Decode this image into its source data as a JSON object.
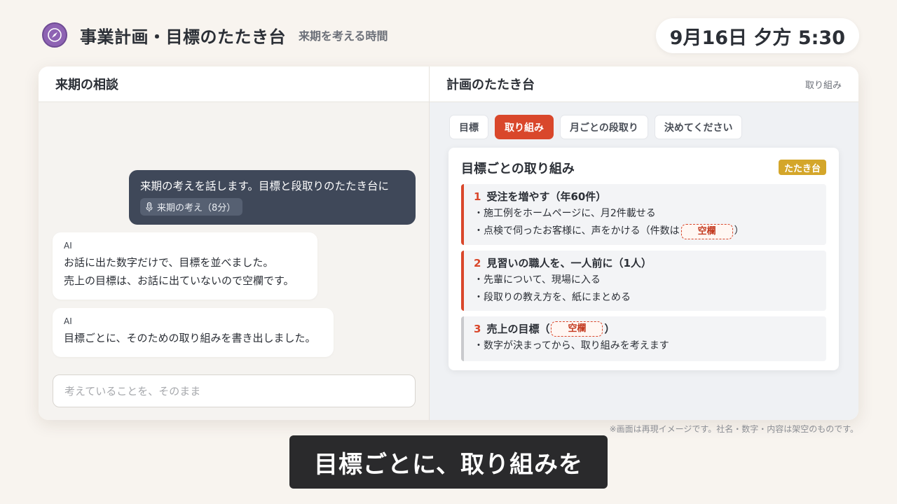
{
  "app": {
    "title": "事業計画・目標のたたき台",
    "subtitle": "来期を考える時間",
    "clock": "9月16日 夕方 5:30",
    "logo_icon": "compass-icon"
  },
  "left_pane": {
    "title": "来期の相談",
    "user_message": {
      "text": "来期の考えを話します。目標と段取りのたたき台に",
      "attachment_icon": "microphone-icon",
      "attachment_label": "来期の考え（8分）"
    },
    "ai_messages": [
      {
        "sender": "AI",
        "lines": [
          "お話に出た数字だけで、目標を並べました。",
          "売上の目標は、お話に出ていないので空欄です。"
        ]
      },
      {
        "sender": "AI",
        "lines": [
          "目標ごとに、そのための取り組みを書き出しました。"
        ]
      }
    ],
    "input_placeholder": "考えていることを、そのまま"
  },
  "right_pane": {
    "title": "計画のたたき台",
    "current_view": "取り組み",
    "tabs": [
      {
        "label": "目標",
        "active": false
      },
      {
        "label": "取り組み",
        "active": true
      },
      {
        "label": "月ごとの段取り",
        "active": false
      },
      {
        "label": "決めてください",
        "active": false
      }
    ],
    "plan": {
      "title": "目標ごとの取り組み",
      "badge": "たたき台",
      "goals": [
        {
          "number": "1",
          "title": "受注を増やす（年60件）",
          "items": [
            "・施工例をホームページに、月2件載せる",
            "・点検で伺ったお客様に、声をかける（件数は",
            "）"
          ]
        },
        {
          "number": "2",
          "title": "見習いの職人を、一人前に（1人）",
          "items": [
            "・先輩について、現場に入る",
            "・段取りの教え方を、紙にまとめる"
          ]
        },
        {
          "number": "3",
          "title_prefix": "売上の目標（",
          "title_suffix": "）",
          "items": [
            "・数字が決まってから、取り組みを考えます"
          ]
        }
      ],
      "blank_label": "空欄"
    }
  },
  "footnote": "※画面は再現イメージです。社名・数字・内容は架空のものです。",
  "caption": "目標ごとに、取り組みを",
  "colors": {
    "accent": "#d9472b",
    "badge": "#d4a62a",
    "user_bubble": "#3f4859",
    "logo": "#8e63b3",
    "background": "#f8f4ef"
  }
}
